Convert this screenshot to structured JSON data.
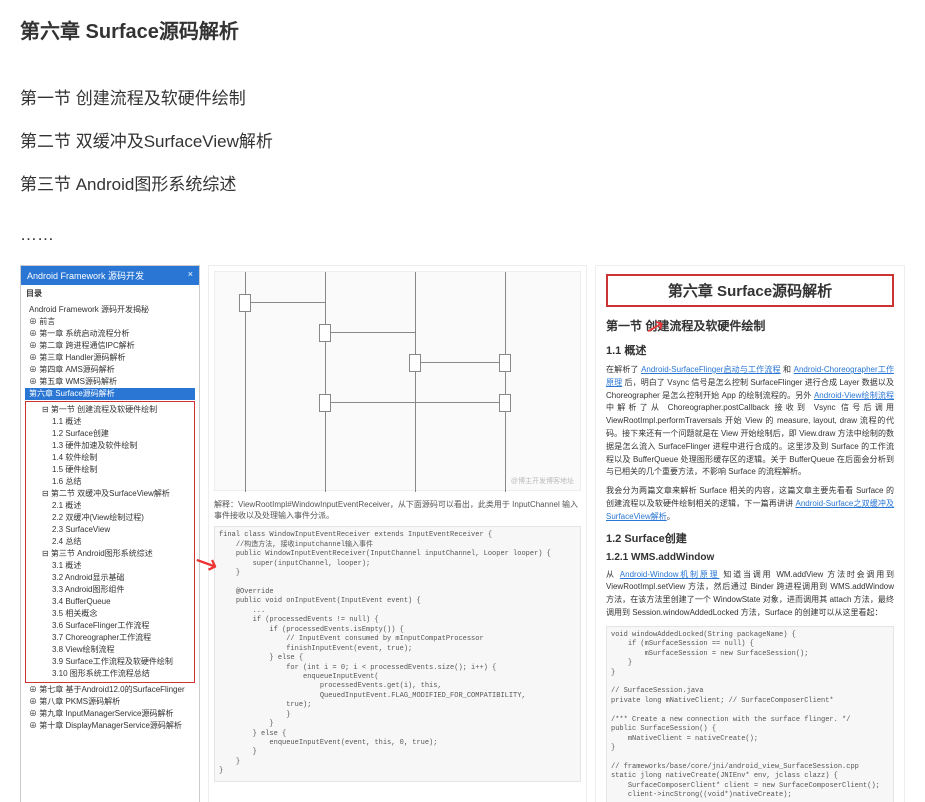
{
  "pageTitle": "第六章 Surface源码解析",
  "sections": [
    "第一节 创建流程及软硬件绘制",
    "第二节 双缓冲及SurfaceView解析",
    "第三节 Android图形系统综述"
  ],
  "ellipsis": "……",
  "sidebar": {
    "tab": "Android Framework 源码开发",
    "title": "目录",
    "root": "Android Framework 源码开发揭秘",
    "items_top": [
      "前言",
      "第一章 系统启动流程分析",
      "第二章 跨进程通信IPC解析",
      "第三章 Handler源码解析",
      "第四章 AMS源码解析",
      "第五章 WMS源码解析"
    ],
    "highlight": "第六章 Surface源码解析",
    "boxed_items": [
      {
        "l": 2,
        "t": "第一节 创建流程及软硬件绘制"
      },
      {
        "l": 3,
        "t": "1.1 概述"
      },
      {
        "l": 3,
        "t": "1.2 Surface创建"
      },
      {
        "l": 3,
        "t": "1.3 硬件加速及软件绘制"
      },
      {
        "l": 3,
        "t": "1.4 软件绘制"
      },
      {
        "l": 3,
        "t": "1.5 硬件绘制"
      },
      {
        "l": 3,
        "t": "1.6 总结"
      },
      {
        "l": 2,
        "t": "第二节 双缓冲及SurfaceView解析"
      },
      {
        "l": 3,
        "t": "2.1 概述"
      },
      {
        "l": 3,
        "t": "2.2 双缓冲(View绘制过程)"
      },
      {
        "l": 3,
        "t": "2.3 SurfaceView"
      },
      {
        "l": 3,
        "t": "2.4 总结"
      },
      {
        "l": 2,
        "t": "第三节 Android图形系统综述"
      },
      {
        "l": 3,
        "t": "3.1 概述"
      },
      {
        "l": 3,
        "t": "3.2 Android显示基础"
      },
      {
        "l": 3,
        "t": "3.3 Android图形组件"
      },
      {
        "l": 3,
        "t": "3.4 BufferQueue"
      },
      {
        "l": 3,
        "t": "3.5 相关概念"
      },
      {
        "l": 3,
        "t": "3.6 SurfaceFlinger工作流程"
      },
      {
        "l": 3,
        "t": "3.7 Choreographer工作流程"
      },
      {
        "l": 3,
        "t": "3.8 View绘制流程"
      },
      {
        "l": 3,
        "t": "3.9 Surface工作流程及软硬件绘制"
      },
      {
        "l": 3,
        "t": "3.10 图形系统工作流程总结"
      }
    ],
    "items_bottom": [
      "第七章 基于Android12.0的SurfaceFlinger",
      "第八章 PKMS源码解析",
      "第九章 InputManagerService源码解析",
      "第十章 DisplayManagerService源码解析"
    ]
  },
  "middle": {
    "explain": "解释：ViewRootImpl#WindowInputEventReceiver，从下面源码可以看出，此类用于 InputChannel 输入事件接收以及处理输入事件分派。",
    "watermark": "@博主开发博客地址",
    "code": "final class WindowInputEventReceiver extends InputEventReceiver {\n    //构造方法, 接收inputchannel输入事件\n    public WindowInputEventReceiver(InputChannel inputChannel, Looper looper) {\n        super(inputChannel, looper);\n    }\n\n    @Override\n    public void onInputEvent(InputEvent event) {\n        ...\n        if (processedEvents != null) {\n            if (processedEvents.isEmpty()) {\n                // InputEvent consumed by mInputCompatProcessor\n                finishInputEvent(event, true);\n            } else {\n                for (int i = 0; i < processedEvents.size(); i++) {\n                    enqueueInputEvent(\n                        processedEvents.get(i), this,\n                        QueuedInputEvent.FLAG_MODIFIED_FOR_COMPATIBILITY,\n                true);\n                }\n            }\n        } else {\n            enqueueInputEvent(event, this, 0, true);\n        }\n    }\n}"
  },
  "right": {
    "boxTitle": "第六章 Surface源码解析",
    "h2": "第一节 创建流程及软硬件绘制",
    "h3a": "1.1 概述",
    "para1_pre": "在解析了 ",
    "link1": "Android-SurfaceFlinger启动与工作流程",
    "para1_mid": " 和 ",
    "link2": "Android-Choreographer工作原理",
    "para1_after": " 后，明白了 Vsync 信号是怎么控制 SurfaceFlinger 进行合成 Layer 数据以及 Choreographer 是怎么控制开始 App 的绘制流程的。另外 ",
    "link3": "Android-View绘制流程",
    "para1_end": " 中解析了从 Choreographer.postCallback 接收到 Vsync 信号后调用 ViewRootImpl.performTraversals 开始 View 的 measure, layout, draw 流程的代码。接下来还有一个问题就是在 View 开始绘制后，即 View.draw 方法中绘制的数据是怎么流入 SurfaceFlinger 进程中进行合成的。这里涉及到 Surface 的工作流程以及 BufferQueue 处理图形缓存区的逻辑。关于 BufferQueue 在后面会分析到与已相关的几个重要方法，不影响 Surface 的流程解析。",
    "para2_pre": "我会分为两篇文章来解析 Surface 相关的内容，这篇文章主要先看看 Surface 的创建流程以及软硬件绘制相关的逻辑，下一篇再讲讲 ",
    "link4": "Android-Surface之双缓冲及SurfaceView解析",
    "para2_end": "。",
    "h3b": "1.2 Surface创建",
    "h4": "1.2.1 WMS.addWindow",
    "para3_pre": "从 ",
    "link5": "Android-Window机制原理",
    "para3_end": " 知道当调用 WM.addView 方法时会调用到 ViewRootImpl.setView 方法，然后通过 Binder 跨进程调用到 WMS.addWindow 方法，在该方法里创建了一个 WindowState 对象，进而调用其 attach 方法，最终调用到 Session.windowAddedLocked 方法，Surface 的创建可以从这里看起：",
    "code": "void windowAddedLocked(String packageName) {\n    if (mSurfaceSession == null) {\n        mSurfaceSession = new SurfaceSession();\n    }\n}\n\n// SurfaceSession.java\nprivate long mNativeClient; // SurfaceComposerClient*\n\n/*** Create a new connection with the surface flinger. */\npublic SurfaceSession() {\n    mNativeClient = nativeCreate();\n}\n\n// frameworks/base/core/jni/android_view_SurfaceSession.cpp\nstatic jlong nativeCreate(JNIEnv* env, jclass clazz) {\n    SurfaceComposerClient* client = new SurfaceComposerClient();\n    client->incStrong((void*)nativeCreate);"
  }
}
